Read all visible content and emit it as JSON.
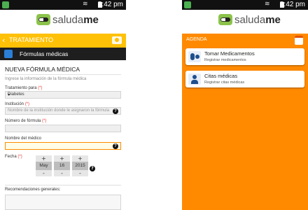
{
  "status": {
    "time": "5:42 pm"
  },
  "app": {
    "logo_prefix": "saluda",
    "logo_suffix": "me"
  },
  "left": {
    "back_title": "TRATAMIENTO",
    "section_title": "Fórmulas médicas",
    "form_title": "NUEVA FÓRMULA MÉDICA",
    "form_subtitle": "Ingrese la información de la fórmula médica",
    "fields": {
      "treatment_label": "Tratamiento para",
      "treatment_value": "Diabetes",
      "institution_label": "Institución",
      "institution_placeholder": "Nombre de la institución donde le asignaron la fórmula",
      "formula_number_label": "Número de fórmula",
      "doctor_label": "Nombre del médico",
      "date_label": "Fecha",
      "recommendations_label": "Recomendaciones generales:"
    },
    "required_mark": "(*)",
    "help_symbol": "?",
    "date": {
      "month": "May",
      "day": "16",
      "year": "2015",
      "plus": "+",
      "minus": "-"
    }
  },
  "right": {
    "section_title": "AGENDA",
    "cards": [
      {
        "title": "Tomar Medicamentos",
        "subtitle": "Registrar medicamentos"
      },
      {
        "title": "Citas médicas",
        "subtitle": "Registrar citas médicas"
      }
    ]
  },
  "colors": {
    "yellow_bar": "#ffc107",
    "orange_bg": "#ff8a00",
    "dark_bar": "#1e1e1e",
    "logo_green": "#8bc34a"
  },
  "icons": [
    "app-notification-icon",
    "wifi-icon",
    "battery-icon",
    "pill-logo-icon",
    "back-chevron-icon",
    "camera-icon",
    "prescription-icon",
    "dropdown-arrow-icon",
    "help-icon",
    "calendar-icon",
    "pills-icon",
    "doctor-icon"
  ]
}
